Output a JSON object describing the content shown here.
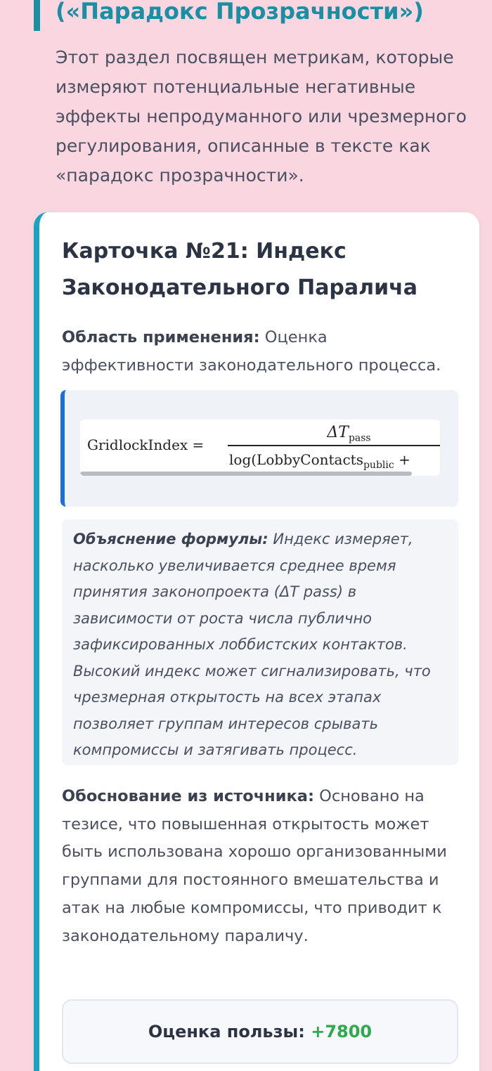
{
  "section": {
    "title": "(«Парадокс Прозрачности»)",
    "intro": "Этот раздел посвящен метрикам, которые измеряют потенциальные негативные эффекты непродуманного или чрезмерного регулирования, описанные в тексте как «парадокс прозрачности»."
  },
  "card": {
    "title": "Карточка №21: Индекс Законодательного Паралича",
    "scope_label": "Область применения:",
    "scope_text": "Оценка эффективности законодательного процесса.",
    "formula": {
      "lhs": "GridlockIndex =",
      "numerator": "ΔT",
      "numerator_sub": "pass",
      "denominator": "log(LobbyContacts",
      "denominator_sub": "public",
      "denominator_tail": " +"
    },
    "explain_label": "Объяснение формулы:",
    "explain_text": "Индекс измеряет, насколько увеличивается среднее время принятия законопроекта (ΔT pass) в зависимости от роста числа публично зафиксированных лоббистских контактов. Высокий индекс может сигнализировать, что чрезмерная открытость на всех этапах позволяет группам интересов срывать компромиссы и затягивать процесс.",
    "basis_label": "Обоснование из источника:",
    "basis_text": "Основано на тезисе, что повышенная открытость может быть использована хорошо организованными группами для постоянного вмешательства и атак на любые компромиссы, что приводит к законодательному параличу.",
    "score_label": "Оценка пользы:",
    "score_value": "+7800"
  }
}
